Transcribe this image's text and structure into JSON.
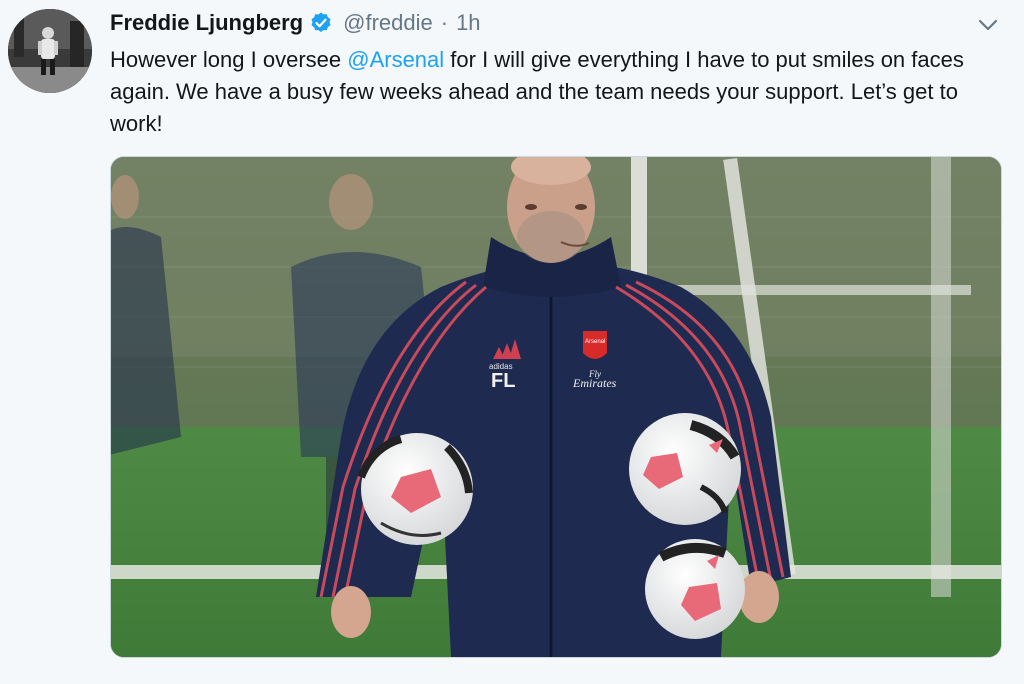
{
  "tweet": {
    "author_name": "Freddie Ljungberg",
    "handle": "@freddie",
    "separator": "·",
    "time": "1h",
    "text_before_mention": "However long I oversee ",
    "mention": "@Arsenal",
    "text_after_mention": " for I will give everything I have to put smiles on faces again. We have a busy few weeks ahead and the team needs your support. Let’s get to work!"
  },
  "photo": {
    "jacket_brand": "adidas",
    "jacket_initials": "FL",
    "crest_text": "Arsenal",
    "sponsor_line1": "Fly",
    "sponsor_line2": "Emirates"
  },
  "colors": {
    "link": "#1da1f2",
    "verified": "#1da1f2",
    "secondary_text": "#657786",
    "background": "#f5f8fa"
  },
  "icons": {
    "verified": "verified-badge-icon",
    "more": "chevron-down-icon"
  }
}
